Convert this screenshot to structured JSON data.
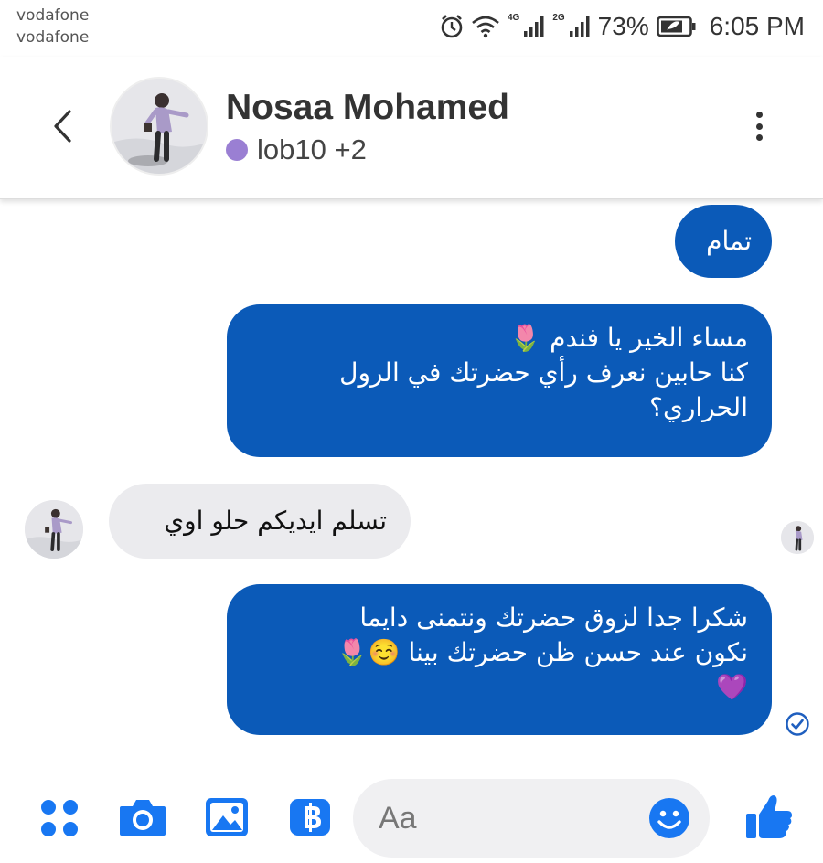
{
  "status_bar": {
    "carrier_1": "vodafone",
    "carrier_2": "vodafone",
    "net_1": "4G",
    "net_2": "2G",
    "battery": "73%",
    "time": "6:05 PM"
  },
  "header": {
    "name": "Nosaa Mohamed",
    "subtitle": "lob10 +2",
    "subtitle_dot_color": "#9a7fd3"
  },
  "messages": [
    {
      "direction": "outgoing",
      "lines": [
        "تمام"
      ]
    },
    {
      "direction": "outgoing",
      "lines": [
        "مساء الخير يا فندم 🌷",
        "كنا حابين نعرف رأي حضرتك في الرول",
        "الحراري؟"
      ]
    },
    {
      "direction": "incoming",
      "lines": [
        "تسلم ايديكم حلو اوي"
      ]
    },
    {
      "direction": "outgoing",
      "lines": [
        "شكرا جدا لزوق حضرتك ونتمنى دايما",
        "نكون عند حسن ظن حضرتك بينا ☺️🌷",
        "💜"
      ]
    }
  ],
  "composer": {
    "placeholder": "Aa"
  },
  "colors": {
    "outgoing_bubble": "#0b5ab8",
    "incoming_bubble": "#ebebee",
    "accent": "#1877f2"
  }
}
